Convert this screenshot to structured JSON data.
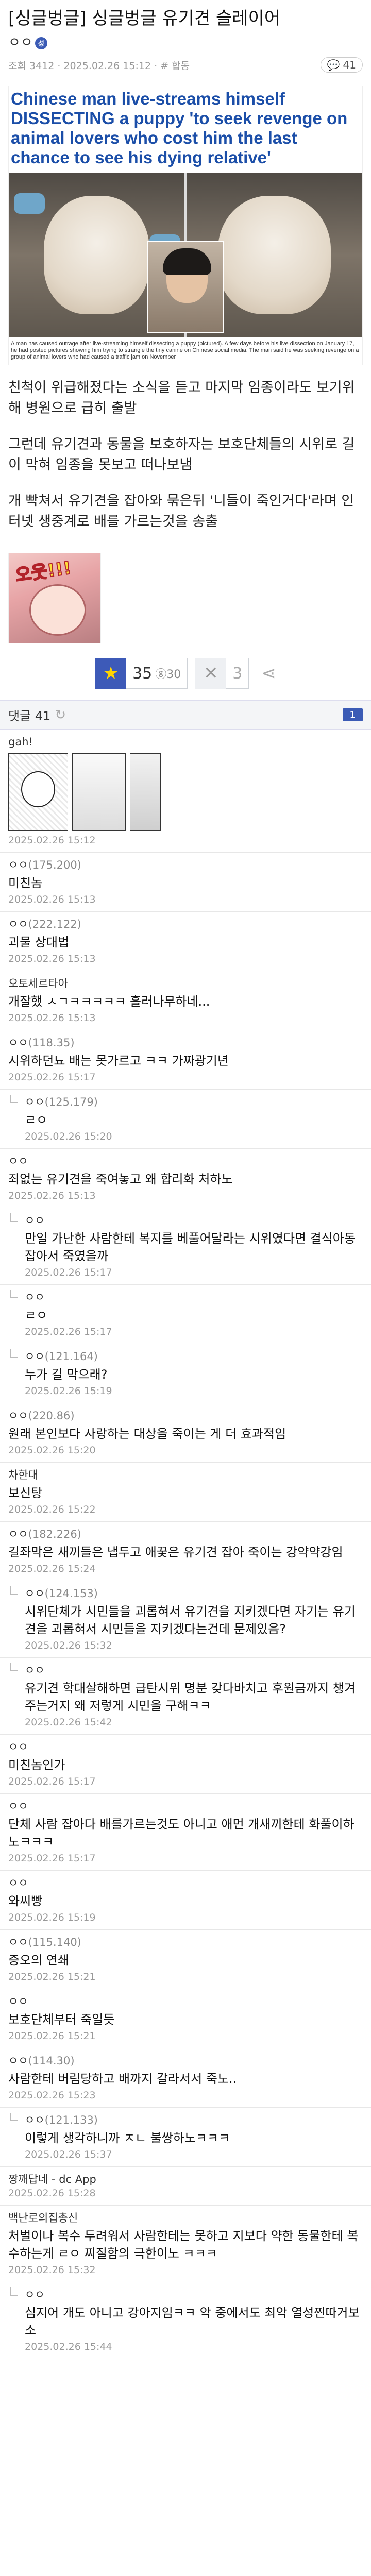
{
  "post": {
    "title": "[싱글벙글] 싱글벙글 유기견 슬레이어",
    "author_badge": "성",
    "stats": "조회 3412 · 2025.02.26 15:12 · # 합동",
    "comment_count": "41",
    "headline": "Chinese man live-streams himself DISSECTING a puppy 'to seek revenge on animal lovers who cost him the last chance to see his dying relative'",
    "caption": "A man has caused outrage after live-streaming himself dissecting a puppy (pictured). A few days before his live dissection on January 17, he had posted pictures showing him trying to strangle the tiny canine on Chinese social media. The man said he was seeking revenge on a group of animal lovers who had caused a traffic jam on November",
    "paragraphs": [
      "친척이 위급해졌다는 소식을 듣고 마지막 임종이라도 보기위해 병원으로 급히 출발",
      "그런데 유기견과 동물을 보호하자는 보호단체들의 시위로 길이 막혀 임종을 못보고 떠나보냄",
      "개 빡쳐서 유기견을 잡아와 묶은뒤 '니들이 죽인거다'라며 인터넷 생중계로 배를 가르는것을 송출"
    ],
    "reaction_text": "오웃!!!"
  },
  "votes": {
    "up_count": "35",
    "up_sub": "30",
    "down_count": "3"
  },
  "comments_header": {
    "label": "댓글 41",
    "page": "1"
  },
  "comments": [
    {
      "nick": "gah!",
      "ip": "",
      "body": "",
      "date": "2025.02.26 15:12",
      "reply": false,
      "manga": true
    },
    {
      "nick": "ㅇㅇ",
      "ip": "(175.200)",
      "body": "미친놈",
      "date": "2025.02.26 15:13",
      "reply": false
    },
    {
      "nick": "ㅇㅇ",
      "ip": "(222.122)",
      "body": "괴물 상대법",
      "date": "2025.02.26 15:13",
      "reply": false
    },
    {
      "nick": "오토세르타아",
      "ip": "",
      "body": "개잘했 ㅅㄱㅋㅋㅋㅋㅋ 흘러나무하네...",
      "date": "2025.02.26 15:13",
      "reply": false
    },
    {
      "nick": "ㅇㅇ",
      "ip": "(118.35)",
      "body": "시위하던뇨 배는 못가르고 ㅋㅋ 가짜광기년",
      "date": "2025.02.26 15:17",
      "reply": false
    },
    {
      "nick": "ㅇㅇ",
      "ip": "(125.179)",
      "body": "ㄹㅇ",
      "date": "2025.02.26 15:20",
      "reply": true
    },
    {
      "nick": "ㅇㅇ",
      "ip": "",
      "body": "죄없는 유기견을 죽여놓고 왜 합리화 처하노",
      "date": "2025.02.26 15:13",
      "reply": false
    },
    {
      "nick": "ㅇㅇ",
      "ip": "",
      "body": "만일 가난한 사람한테 복지를 베풀어달라는 시위였다면 결식아동 잡아서 죽였을까",
      "date": "2025.02.26 15:17",
      "reply": true
    },
    {
      "nick": "ㅇㅇ",
      "ip": "",
      "body": "ㄹㅇ",
      "date": "2025.02.26 15:17",
      "reply": true
    },
    {
      "nick": "ㅇㅇ",
      "ip": "(121.164)",
      "body": "누가 길 막으래?",
      "date": "2025.02.26 15:19",
      "reply": true
    },
    {
      "nick": "ㅇㅇ",
      "ip": "(220.86)",
      "body": "원래 본인보다 사랑하는 대상을 죽이는 게 더 효과적임",
      "date": "2025.02.26 15:20",
      "reply": false
    },
    {
      "nick": "차한대",
      "ip": "",
      "body": "보신탕",
      "date": "2025.02.26 15:22",
      "reply": false
    },
    {
      "nick": "ㅇㅇ",
      "ip": "(182.226)",
      "body": "길좌막은 새끼들은 냅두고 애꿎은 유기견 잡아 죽이는 강약약강임",
      "date": "2025.02.26 15:24",
      "reply": false
    },
    {
      "nick": "ㅇㅇ",
      "ip": "(124.153)",
      "body": "시위단체가 시민들을 괴롭혀서 유기견을 지키겠다면 자기는 유기견을 괴롭혀서 시민들을 지키겠다는건데 문제있음?",
      "date": "2025.02.26 15:32",
      "reply": true
    },
    {
      "nick": "ㅇㅇ",
      "ip": "",
      "body": "유기견 학대살해하면 급탄시위 명분 갖다바치고 후원금까지 챙겨주는거지 왜 저렇게 시민을 구해ㅋㅋ",
      "date": "2025.02.26 15:42",
      "reply": true
    },
    {
      "nick": "ㅇㅇ",
      "ip": "",
      "body": "미친놈인가",
      "date": "2025.02.26 15:17",
      "reply": false
    },
    {
      "nick": "ㅇㅇ",
      "ip": "",
      "body": "단체 사람 잡아다 배를가르는것도 아니고 애먼 개새끼한테 화풀이하노ㅋㅋㅋ",
      "date": "2025.02.26 15:17",
      "reply": false
    },
    {
      "nick": "ㅇㅇ",
      "ip": "",
      "body": "와씨빵",
      "date": "2025.02.26 15:19",
      "reply": false
    },
    {
      "nick": "ㅇㅇ",
      "ip": "(115.140)",
      "body": "증오의 연쇄",
      "date": "2025.02.26 15:21",
      "reply": false
    },
    {
      "nick": "ㅇㅇ",
      "ip": "",
      "body": "보호단체부터 죽일듯",
      "date": "2025.02.26 15:21",
      "reply": false
    },
    {
      "nick": "ㅇㅇ",
      "ip": "(114.30)",
      "body": "사람한테 버림당하고 배까지 갈라서서 죽노..",
      "date": "2025.02.26 15:23",
      "reply": false
    },
    {
      "nick": "ㅇㅇ",
      "ip": "(121.133)",
      "body": "이렇게 생각하니까 ㅈㄴ 불쌍하노ㅋㅋㅋ",
      "date": "2025.02.26 15:37",
      "reply": true
    },
    {
      "nick": "짱깨답네 - dc App",
      "ip": "",
      "body": "",
      "date": "2025.02.26 15:28",
      "reply": false
    },
    {
      "nick": "백난로의집총신",
      "ip": "",
      "body": "처벌이나 복수 두려워서 사람한테는 못하고 지보다 약한 동물한테 복수하는게 ㄹㅇ 찌질함의 극한이노 ㅋㅋㅋ",
      "date": "2025.02.26 15:32",
      "reply": false
    },
    {
      "nick": "ㅇㅇ",
      "ip": "",
      "body": "심지어 개도 아니고 강아지임ㅋㅋ 악 중에서도 최악 열성찐따거보소",
      "date": "2025.02.26 15:44",
      "reply": true
    }
  ]
}
